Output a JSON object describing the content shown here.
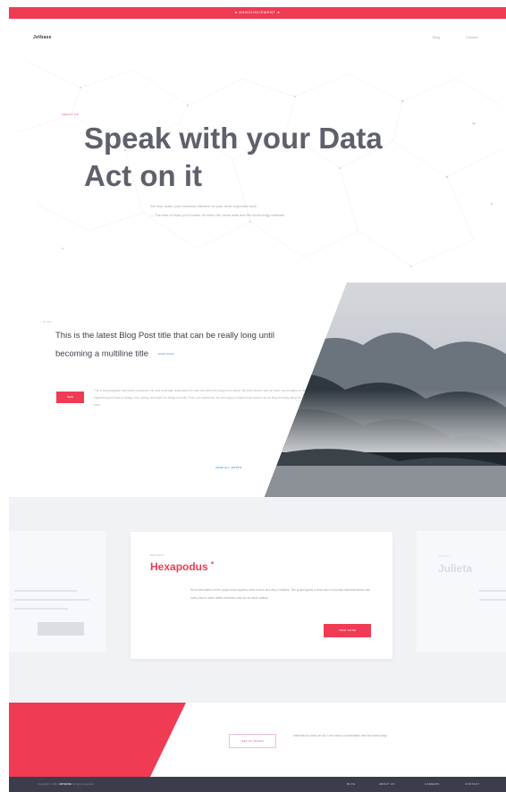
{
  "topbar": {
    "text": "● ANNOUNCEMENT ●"
  },
  "nav": {
    "logo": "Jetbase",
    "links": [
      "Blog",
      "Contact"
    ]
  },
  "hero": {
    "tag": "ABOUT US",
    "title_line1": "Speak with your Data",
    "title_line2": "Act on it",
    "subtitle_line1": "We help make your business effective on your most important work.",
    "subtitle_line2": "— The kind of work you'd rather do when the clean data and the technology matches."
  },
  "blog": {
    "meta": "— BLOG",
    "title": "This is the latest Blog Post title that can be really long until becoming a multiline title",
    "read_label": "read more",
    "badge": "NEW",
    "excerpt": "This is the paragraph that shortly introduces the post so people understand the idea and what this blog post is about. We write about it and we share our thoughts on the engineering and how to design, test, deploy, and scale the things we build. From our experience, we are happy to share those lessons as we keep learning along the way. Read more.",
    "more_label": "VIEW ALL POSTS"
  },
  "projects": {
    "main": {
      "tag": "PROJECT",
      "title": "Hexapodus",
      "title_mark": "*",
      "description": "Short description of the project that explains what it does and why it matters. The project gives a clear view of product data that teams use every day to make better decisions and act on what matters.",
      "button": "VIEW CASE"
    },
    "right": {
      "tag": "PROJECT",
      "title": "Julieta"
    }
  },
  "contact": {
    "button": "GET IN TOUCH",
    "text": "Interested in what we do? Let's start a conversation with the team today."
  },
  "footer": {
    "copyright_prefix": "Copyright © 2019",
    "company": "JETBASE",
    "copyright_suffix": "All rights reserved",
    "links": [
      "BLOG",
      "ABOUT US",
      "CAREERS",
      "CONTACT"
    ]
  },
  "colors": {
    "accent": "#ef3b54",
    "footer": "#3c3d4a",
    "link": "#4b9be0",
    "panel": "#f1f2f6"
  }
}
